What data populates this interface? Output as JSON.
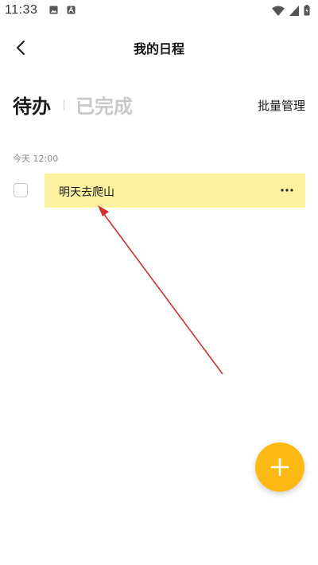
{
  "status_bar": {
    "time": "11:33",
    "icons": [
      "image-icon",
      "text-a-icon",
      "wifi-icon",
      "signal-icon",
      "battery-icon"
    ]
  },
  "header": {
    "title": "我的日程",
    "back_icon": "chevron-left-icon"
  },
  "tabs": {
    "active_label": "待办",
    "inactive_label": "已完成",
    "batch_manage_label": "批量管理"
  },
  "tasks": {
    "section_time": "今天 12:00",
    "items": [
      {
        "text": "明天去爬山",
        "checked": false,
        "highlight_color": "#fdf09e",
        "more_icon": "more-horizontal-icon"
      }
    ]
  },
  "fab": {
    "icon": "plus-icon",
    "color": "#fdb913"
  },
  "annotation": {
    "type": "arrow",
    "color": "#d13030"
  }
}
